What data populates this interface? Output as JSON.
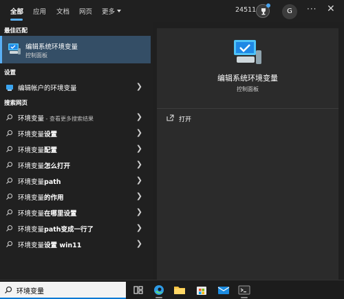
{
  "tabs": [
    {
      "label": "全部",
      "active": true
    },
    {
      "label": "应用"
    },
    {
      "label": "文档"
    },
    {
      "label": "网页"
    },
    {
      "label": "更多"
    }
  ],
  "header": {
    "points": "24511",
    "avatar_letter": "G",
    "more_icon": "ellipsis-icon",
    "close_icon": "close-icon"
  },
  "sections": {
    "best": "最佳匹配",
    "settings": "设置",
    "web": "搜索网页"
  },
  "best_match": {
    "name": "编辑系统环境变量",
    "sub": "控制面板"
  },
  "settings_items": [
    {
      "label": "编辑帐户的环境变量"
    }
  ],
  "web_items": [
    {
      "prefix": "环境变量",
      "bold": "",
      "hint": " - 查看更多搜索结果"
    },
    {
      "prefix": "环境变量",
      "bold": "设置",
      "hint": ""
    },
    {
      "prefix": "环境变量",
      "bold": "配置",
      "hint": ""
    },
    {
      "prefix": "环境变量",
      "bold": "怎么打开",
      "hint": ""
    },
    {
      "prefix": "环境变量",
      "bold": "path",
      "hint": ""
    },
    {
      "prefix": "环境变量",
      "bold": "的作用",
      "hint": ""
    },
    {
      "prefix": "环境变量",
      "bold": "在哪里设置",
      "hint": ""
    },
    {
      "prefix": "环境变量",
      "bold": "path变成一行了",
      "hint": ""
    },
    {
      "prefix": "环境变量",
      "bold": "设置 win11",
      "hint": ""
    }
  ],
  "detail": {
    "title": "编辑系统环境变量",
    "sub": "控制面板",
    "open_label": "打开"
  },
  "search": {
    "value": "环境变量"
  },
  "colors": {
    "accent": "#5ab0f5",
    "selected_bg": "#344e66"
  }
}
